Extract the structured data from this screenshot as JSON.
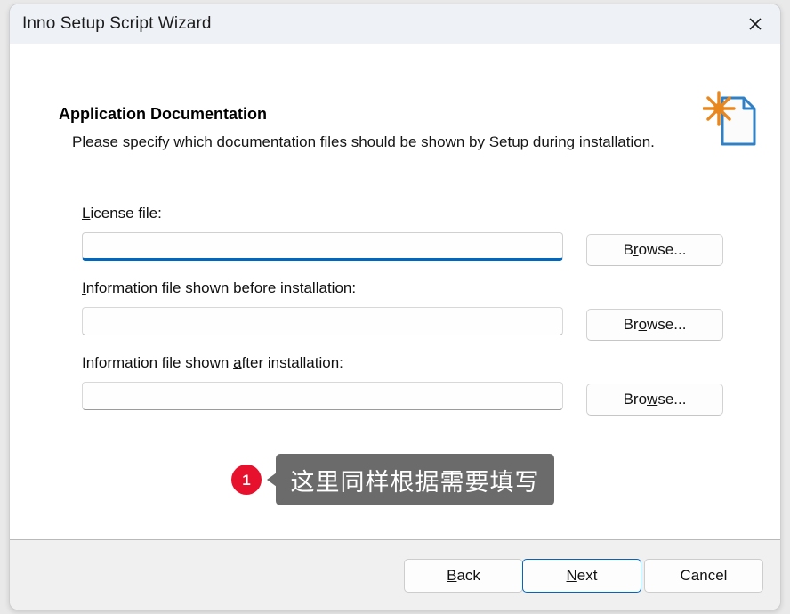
{
  "window": {
    "title": "Inno Setup Script Wizard",
    "close_icon": "close-icon"
  },
  "header": {
    "title": "Application Documentation",
    "description": "Please specify which documentation files should be shown by Setup during installation.",
    "icon": "document-sparkle-icon"
  },
  "fields": [
    {
      "label_prefix": "",
      "label_accel": "L",
      "label_suffix": "icense file:",
      "value": "",
      "placeholder": "",
      "focused": true,
      "browse": {
        "prefix": "B",
        "accel": "r",
        "suffix": "owse..."
      }
    },
    {
      "label_prefix": "",
      "label_accel": "I",
      "label_suffix": "nformation file shown before installation:",
      "value": "",
      "placeholder": "",
      "focused": false,
      "browse": {
        "prefix": "Br",
        "accel": "o",
        "suffix": "wse..."
      }
    },
    {
      "label_prefix": "Information file shown ",
      "label_accel": "a",
      "label_suffix": "fter installation:",
      "value": "",
      "placeholder": "",
      "focused": false,
      "browse": {
        "prefix": "Bro",
        "accel": "w",
        "suffix": "se..."
      }
    }
  ],
  "annotation": {
    "badge": "1",
    "text": "这里同样根据需要填写",
    "bubble_color": "#6b6b6b",
    "badge_color": "#e8112d"
  },
  "footer": {
    "back": {
      "prefix": "",
      "accel": "B",
      "suffix": "ack"
    },
    "next": {
      "prefix": "",
      "accel": "N",
      "suffix": "ext"
    },
    "cancel": {
      "prefix": "Cancel",
      "accel": "",
      "suffix": ""
    }
  },
  "colors": {
    "accent": "#0067c0",
    "titlebar": "#eef2f7",
    "footer": "#f0f0f0",
    "icon_blue": "#2f80c4",
    "icon_orange": "#e8871e"
  }
}
